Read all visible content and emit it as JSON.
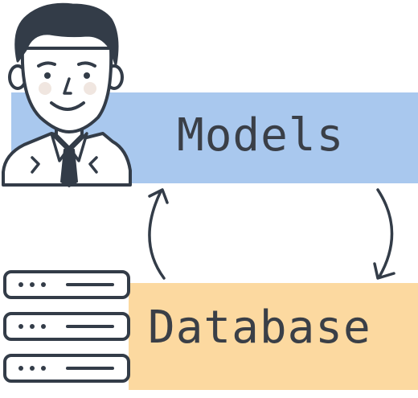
{
  "diagram": {
    "nodes": [
      {
        "id": "models",
        "label": "Models",
        "color": "#a9c8ee",
        "icon": "person-icon"
      },
      {
        "id": "database",
        "label": "Database",
        "color": "#fcd9a0",
        "icon": "server-stack-icon"
      }
    ],
    "edges": [
      {
        "from": "database",
        "to": "models",
        "icon": "curved-arrow-up-icon"
      },
      {
        "from": "models",
        "to": "database",
        "icon": "curved-arrow-down-icon"
      }
    ]
  },
  "colors": {
    "stroke": "#333c48",
    "text": "#3a3f47",
    "skin": "#ffffff",
    "hair": "#333c48",
    "cheek": "#f0e6e0"
  }
}
